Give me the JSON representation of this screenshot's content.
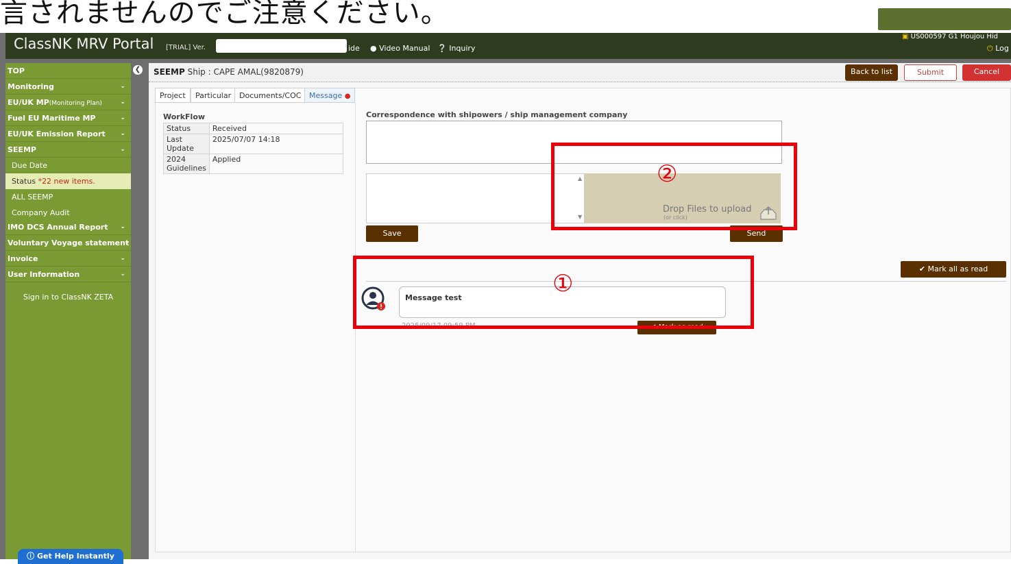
{
  "banner": {
    "text": "言されませんのでご注意ください。"
  },
  "header": {
    "app_title": "ClassNK MRV Portal",
    "trial_label": "[TRIAL] Ver.",
    "guide_label": "ide",
    "video_manual_label": "Video Manual",
    "inquiry_label": "Inquiry",
    "user_id": "US000597 G1 Houjou Hid",
    "logout_label": "Log"
  },
  "sidebar": {
    "items": [
      {
        "label": "TOP"
      },
      {
        "label": "Monitoring"
      },
      {
        "label": "EU/UK MP",
        "sub": "(Monitoring Plan)"
      },
      {
        "label": "Fuel EU Maritime MP"
      },
      {
        "label": "EU/UK Emission Report"
      },
      {
        "label": "SEEMP"
      },
      {
        "label": "IMO DCS Annual Report"
      },
      {
        "label": "Voluntary Voyage statement"
      },
      {
        "label": "Invoice"
      },
      {
        "label": "User Information"
      }
    ],
    "seemp_subitems": [
      {
        "label": "Due Date"
      },
      {
        "label": "Status",
        "note": "*22 new items."
      },
      {
        "label": "ALL SEEMP"
      },
      {
        "label": "Company Audit"
      }
    ],
    "zeta_link": "Sign in to ClassNK ZETA",
    "help_button": "Get Help Instantly"
  },
  "page": {
    "section": "SEEMP",
    "ship_label": "Ship : CAPE AMAL(9820879)",
    "buttons": {
      "back": "Back to list",
      "submit": "Submit",
      "cancel": "Cancel"
    },
    "tabs": [
      "Project",
      "Particular",
      "Documents/COC",
      "Message"
    ]
  },
  "workflow": {
    "title": "WorkFlow",
    "rows": [
      {
        "key": "Status",
        "value": "Received"
      },
      {
        "key": "Last Update",
        "value": "2025/07/07 14:18"
      },
      {
        "key": "2024 Guidelines",
        "value": "Applied"
      }
    ]
  },
  "message_area": {
    "correspondence_label": "Correspondence with shipowers / ship management company",
    "drop_text": "Drop Files to upload",
    "drop_subtext": "(or click)",
    "save_button": "Save",
    "send_button": "Send",
    "mark_all_read": "Mark all as read",
    "message_text": "Message test",
    "message_date": "2025/09/17 09:59 PM",
    "mark_as_read": "Mark as read"
  },
  "annotations": {
    "one": "①",
    "two": "②"
  },
  "colors": {
    "sidebar": "#7a9a33",
    "topbar": "#2f3b1e",
    "button_brown": "#5a3000",
    "annotation_red": "#e8000b"
  }
}
